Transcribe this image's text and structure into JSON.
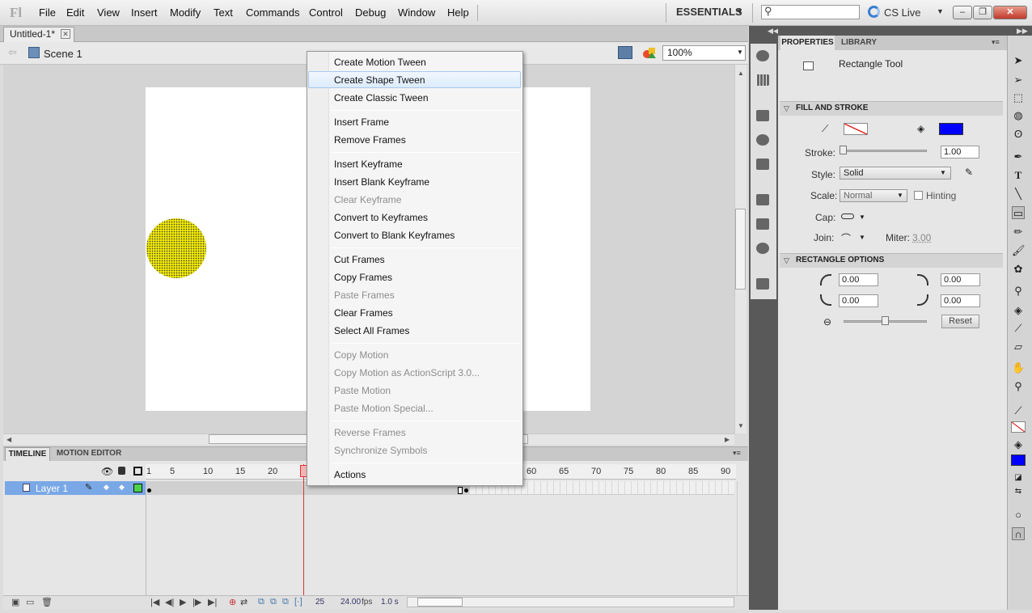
{
  "app": {
    "logo": "Fl"
  },
  "menubar": {
    "items": [
      "File",
      "Edit",
      "View",
      "Insert",
      "Modify",
      "Text",
      "Commands",
      "Control",
      "Debug",
      "Window",
      "Help"
    ],
    "workspace": "ESSENTIALS",
    "search_placeholder": "",
    "cs_live": "CS Live"
  },
  "document": {
    "tab_title": "Untitled-1*"
  },
  "editbar": {
    "scene": "Scene 1",
    "zoom": "100%"
  },
  "timeline": {
    "tabs": [
      "TIMELINE",
      "MOTION EDITOR"
    ],
    "frame_ticks": [
      "1",
      "5",
      "10",
      "15",
      "20",
      "2",
      "60",
      "65",
      "70",
      "75",
      "80",
      "85",
      "90"
    ],
    "layer": "Layer 1",
    "current_frame": "25",
    "fps": "24.00",
    "fps_unit": "fps",
    "elapsed": "1.0 s"
  },
  "properties": {
    "tabs": [
      "PROPERTIES",
      "LIBRARY"
    ],
    "tool_name": "Rectangle Tool",
    "fill_stroke": {
      "title": "FILL AND STROKE",
      "stroke_label": "Stroke:",
      "stroke_value": "1.00",
      "style_label": "Style:",
      "style_value": "Solid",
      "scale_label": "Scale:",
      "scale_value": "Normal",
      "hinting_label": "Hinting",
      "cap_label": "Cap:",
      "join_label": "Join:",
      "miter_label": "Miter:",
      "miter_value": "3.00",
      "stroke_color": "#ff0000",
      "fill_color": "#0000ff"
    },
    "rect_options": {
      "title": "RECTANGLE OPTIONS",
      "radii": [
        "0.00",
        "0.00",
        "0.00",
        "0.00"
      ],
      "reset": "Reset"
    }
  },
  "context_menu": {
    "groups": [
      [
        {
          "label": "Create Motion Tween",
          "enabled": true
        },
        {
          "label": "Create Shape Tween",
          "enabled": true,
          "highlighted": true
        },
        {
          "label": "Create Classic Tween",
          "enabled": true
        }
      ],
      [
        {
          "label": "Insert Frame",
          "enabled": true
        },
        {
          "label": "Remove Frames",
          "enabled": true
        }
      ],
      [
        {
          "label": "Insert Keyframe",
          "enabled": true
        },
        {
          "label": "Insert Blank Keyframe",
          "enabled": true
        },
        {
          "label": "Clear Keyframe",
          "enabled": false
        },
        {
          "label": "Convert to Keyframes",
          "enabled": true
        },
        {
          "label": "Convert to Blank Keyframes",
          "enabled": true
        }
      ],
      [
        {
          "label": "Cut Frames",
          "enabled": true
        },
        {
          "label": "Copy Frames",
          "enabled": true
        },
        {
          "label": "Paste Frames",
          "enabled": false
        },
        {
          "label": "Clear Frames",
          "enabled": true
        },
        {
          "label": "Select All Frames",
          "enabled": true
        }
      ],
      [
        {
          "label": "Copy Motion",
          "enabled": false
        },
        {
          "label": "Copy Motion as ActionScript 3.0...",
          "enabled": false
        },
        {
          "label": "Paste Motion",
          "enabled": false
        },
        {
          "label": "Paste Motion Special...",
          "enabled": false
        }
      ],
      [
        {
          "label": "Reverse Frames",
          "enabled": false
        },
        {
          "label": "Synchronize Symbols",
          "enabled": false
        }
      ],
      [
        {
          "label": "Actions",
          "enabled": true
        }
      ]
    ]
  },
  "colors": {
    "stage_circle": "#f2ea00",
    "layer_highlight": "#7aa8e6",
    "accent": "#3a7fd0"
  }
}
